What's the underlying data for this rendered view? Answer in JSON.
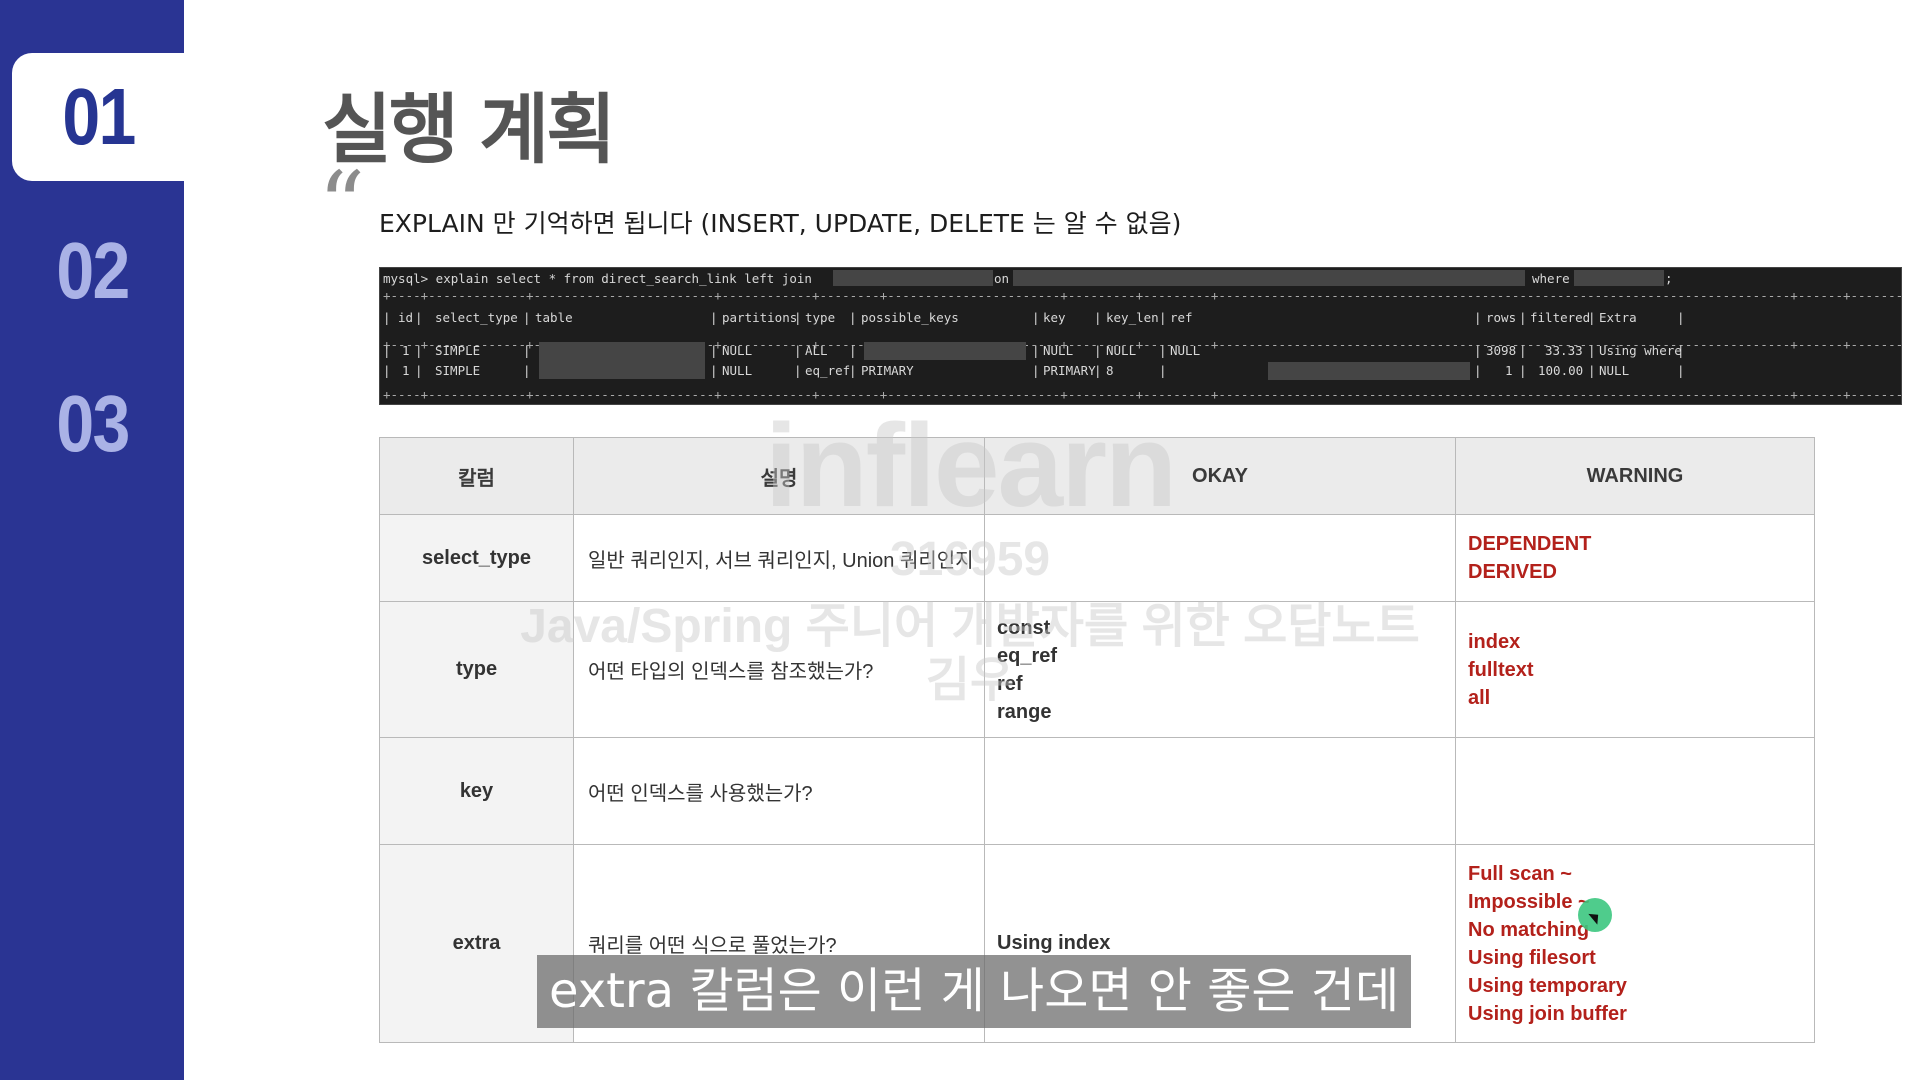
{
  "sidebar": {
    "items": [
      {
        "label": "01",
        "active": true
      },
      {
        "label": "02",
        "active": false
      },
      {
        "label": "03",
        "active": false
      }
    ]
  },
  "slide": {
    "title": "실행 계획",
    "quote_mark": "“",
    "subtitle": "EXPLAIN 만 기억하면 됩니다 (INSERT, UPDATE, DELETE 는 알 수 없음)"
  },
  "terminal": {
    "command_prefix": "mysql> explain select * from direct_search_link left join",
    "on_kw": "on",
    "where_kw": "where",
    "semicolon": ";",
    "headers": [
      "id",
      "select_type",
      "table",
      "partitions",
      "type",
      "possible_keys",
      "key",
      "key_len",
      "ref",
      "rows",
      "filtered",
      "Extra"
    ],
    "rows": [
      {
        "id": "1",
        "select_type": "SIMPLE",
        "partitions": "NULL",
        "type": "ALL",
        "key": "NULL",
        "key_len": "NULL",
        "ref": "NULL",
        "rows": "3098",
        "filtered": "33.33",
        "extra": "Using where"
      },
      {
        "id": "1",
        "select_type": "SIMPLE",
        "partitions": "NULL",
        "type": "eq_ref",
        "possible_keys": "PRIMARY",
        "key": "PRIMARY",
        "key_len": "8",
        "rows": "1",
        "filtered": "100.00",
        "extra": "NULL"
      }
    ]
  },
  "table": {
    "headers": [
      "칼럼",
      "설명",
      "OKAY",
      "WARNING"
    ],
    "rows": [
      {
        "label": "select_type",
        "desc": "일반 쿼리인지, 서브 쿼리인지, Union 쿼리인지",
        "okay": [],
        "warning": [
          "DEPENDENT",
          "DERIVED"
        ]
      },
      {
        "label": "type",
        "desc": "어떤 타입의 인덱스를 참조했는가?",
        "okay": [
          "const",
          "eq_ref",
          "ref",
          "range"
        ],
        "warning": [
          "index",
          "fulltext",
          "all"
        ]
      },
      {
        "label": "key",
        "desc": "어떤 인덱스를 사용했는가?",
        "okay": [],
        "warning": []
      },
      {
        "label": "extra",
        "desc": "쿼리를 어떤 식으로 풀었는가?",
        "okay": [
          "Using index"
        ],
        "warning": [
          "Full scan ~",
          "Impossible ~",
          "No matching",
          "Using filesort",
          "Using temporary",
          "Using join buffer"
        ]
      }
    ]
  },
  "watermark": {
    "logo": "inflearn",
    "id": "316959",
    "course": "Java/Spring 주니어 개발자를 위한 오답노트",
    "author": "김우"
  },
  "caption": "extra 칼럼은 이런 게 나오면 안 좋은 건데",
  "colors": {
    "sidebar": "#2a3493",
    "warning_text": "#b3211b",
    "terminal_bg": "#1d1d1d"
  }
}
